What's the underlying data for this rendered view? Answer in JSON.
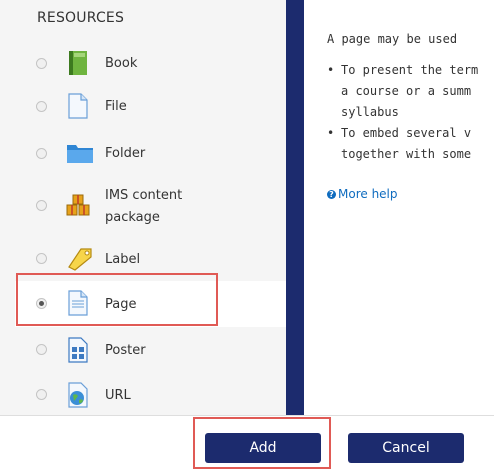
{
  "resources": {
    "header": "RESOURCES",
    "items": [
      {
        "label": "Book",
        "icon": "book-icon",
        "selected": false
      },
      {
        "label": "File",
        "icon": "file-icon",
        "selected": false
      },
      {
        "label": "Folder",
        "icon": "folder-icon",
        "selected": false
      },
      {
        "label_line1": "IMS content",
        "label_line2": "package",
        "icon": "ims-package-icon",
        "selected": false
      },
      {
        "label": "Label",
        "icon": "label-tag-icon",
        "selected": false
      },
      {
        "label": "Page",
        "icon": "page-icon",
        "selected": true
      },
      {
        "label": "Poster",
        "icon": "poster-icon",
        "selected": false
      },
      {
        "label": "URL",
        "icon": "url-globe-icon",
        "selected": false
      }
    ]
  },
  "help": {
    "intro": "A page may be used",
    "bullets": [
      [
        "To present the term",
        "a course or a summ",
        "syllabus"
      ],
      [
        "To embed several v",
        "together with some"
      ]
    ],
    "more_help": "More help"
  },
  "footer": {
    "add_label": "Add",
    "cancel_label": "Cancel"
  },
  "colors": {
    "accent": "#1c2b6e",
    "highlight": "#e05a55",
    "link": "#0f6cbf"
  }
}
